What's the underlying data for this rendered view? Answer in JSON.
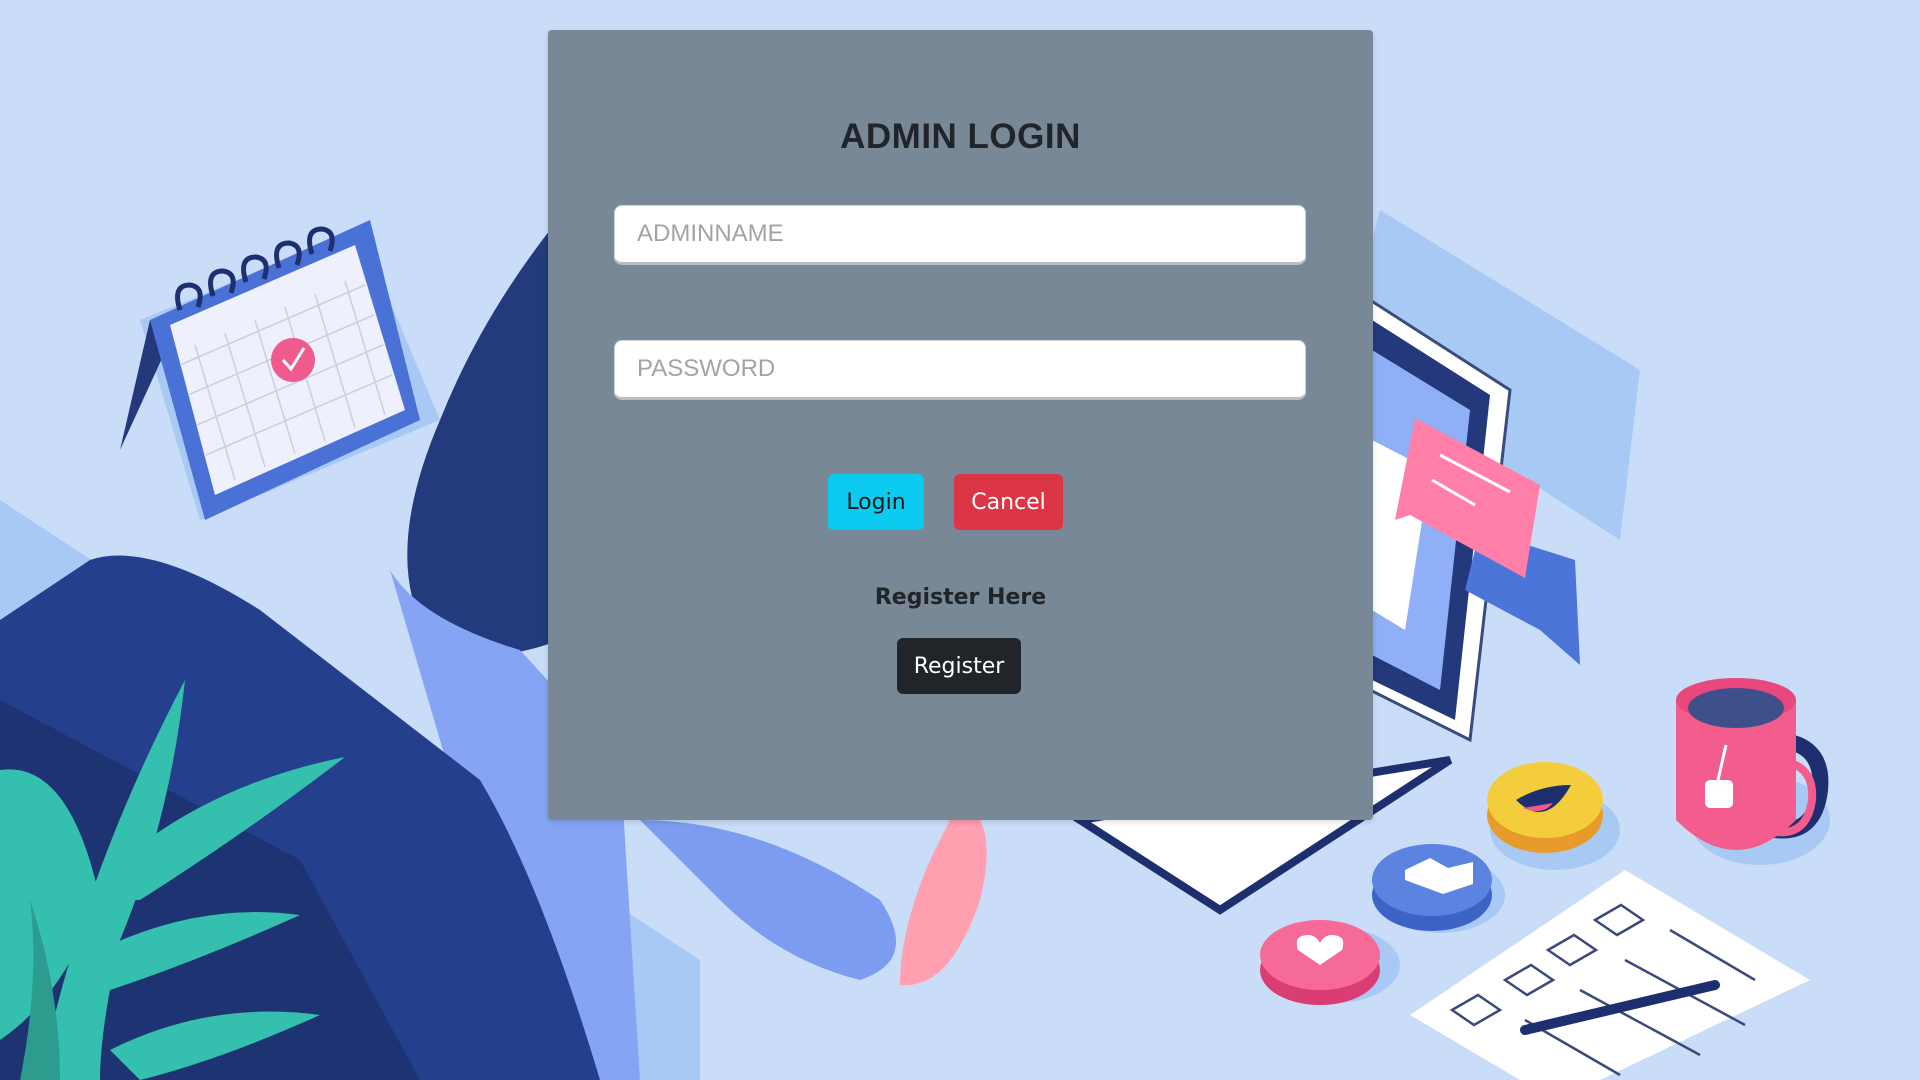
{
  "login_form": {
    "title": "ADMIN LOGIN",
    "adminname_placeholder": "ADMINNAME",
    "password_placeholder": "PASSWORD",
    "login_label": "Login",
    "cancel_label": "Cancel",
    "register_prompt": "Register Here",
    "register_label": "Register"
  },
  "colors": {
    "page_background": "#c9ddf9",
    "panel_background": "#788897",
    "login_button": "#0dcaf0",
    "cancel_button": "#dc3545",
    "register_button": "#212529"
  },
  "background_illustration": {
    "icons": [
      "calendar-icon",
      "plant-icon",
      "laptop-icon",
      "chat-bubble-icon",
      "mug-icon",
      "laughing-emoji-icon",
      "thumbs-up-icon",
      "heart-icon",
      "checklist-icon",
      "pen-icon"
    ]
  }
}
